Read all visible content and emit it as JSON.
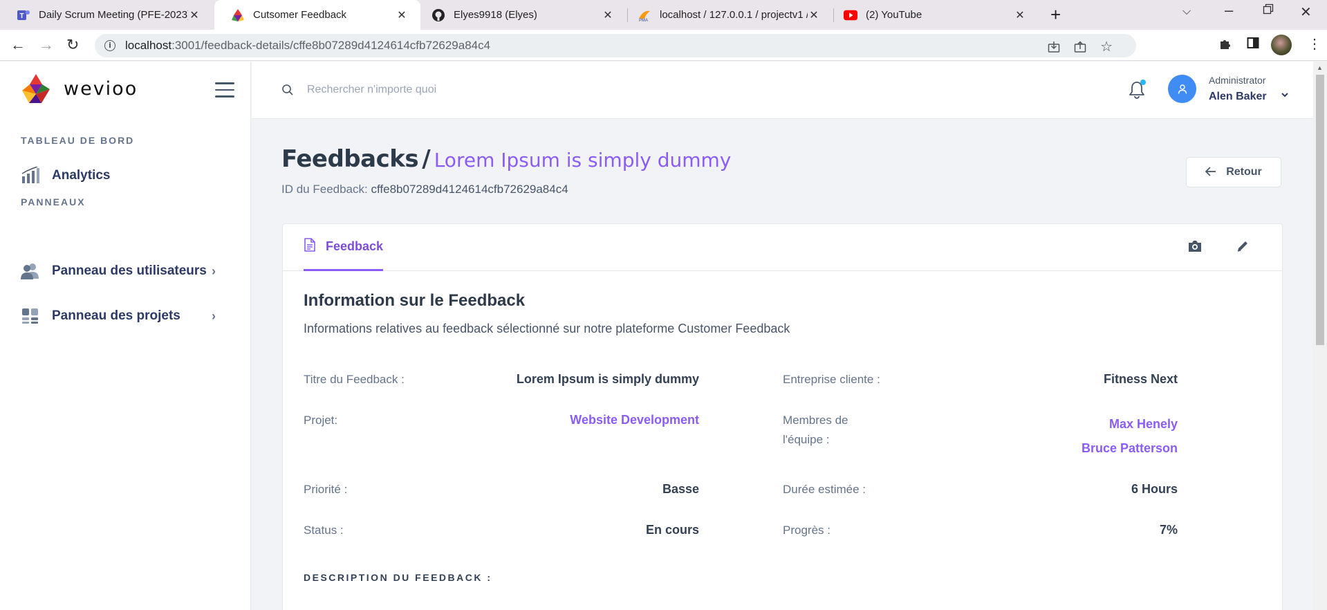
{
  "browser": {
    "tabs": [
      {
        "title": "Daily Scrum Meeting (PFE-2023)",
        "icon": "teams-icon"
      },
      {
        "title": "Cutsomer Feedback",
        "icon": "wevioo-icon"
      },
      {
        "title": "Elyes9918 (Elyes)",
        "icon": "github-icon"
      },
      {
        "title": "localhost / 127.0.0.1 / projectv1 /",
        "icon": "phpmyadmin-icon"
      },
      {
        "title": "(2) YouTube",
        "icon": "youtube-icon"
      }
    ],
    "url_host": "localhost",
    "url_path": ":3001/feedback-details/cffe8b07289d4124614cfb72629a84c4"
  },
  "sidebar": {
    "brand": "wevioo",
    "section_dashboard": "TABLEAU DE BORD",
    "analytics": "Analytics",
    "section_panels": "PANNEAUX",
    "users_panel": "Panneau des utilisateurs",
    "projects_panel": "Panneau des projets"
  },
  "topbar": {
    "search_placeholder": "Rechercher n'importe quoi",
    "user_role": "Administrator",
    "user_name": "Alen Baker"
  },
  "page": {
    "crumb_lead": "Feedbacks",
    "crumb_sep": "/",
    "crumb_current": "Lorem Ipsum is simply dummy",
    "id_label": "ID du Feedback:",
    "id_value": "cffe8b07289d4124614cfb72629a84c4",
    "back_label": "Retour"
  },
  "card": {
    "tab_label": "Feedback",
    "title": "Information sur le Feedback",
    "subtitle": "Informations relatives au feedback sélectionné sur notre plateforme Customer Feedback",
    "fields": {
      "title_label": "Titre du Feedback :",
      "title_value": "Lorem Ipsum is simply dummy",
      "company_label": "Entreprise cliente :",
      "company_value": "Fitness Next",
      "project_label": "Projet:",
      "project_value": "Website Development",
      "team_label_1": "Membres de",
      "team_label_2": "l'équipe :",
      "team_members": [
        "Max Henely",
        "Bruce Patterson"
      ],
      "priority_label": "Priorité :",
      "priority_value": "Basse",
      "duration_label": "Durée estimée :",
      "duration_value": "6 Hours",
      "status_label": "Status :",
      "status_value": "En cours",
      "progress_label": "Progrès :",
      "progress_value": "7%"
    },
    "description_title": "DESCRIPTION DU FEEDBACK :"
  },
  "colors": {
    "accent": "#8b5cf6",
    "navy": "#2d3a66",
    "avatar": "#3f8cf5"
  }
}
